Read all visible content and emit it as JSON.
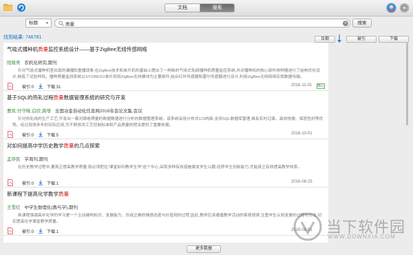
{
  "tabs": [
    {
      "label": "文档",
      "active": false
    },
    {
      "label": "搜索",
      "active": true
    }
  ],
  "search": {
    "field": "标题",
    "query": "质量",
    "button": "搜索"
  },
  "result_count": "找到结果: 746781",
  "sort": {
    "date": "日期",
    "cite": "被引",
    "download": "下载"
  },
  "results": [
    {
      "title_pre": "气吸式播种机",
      "title_hl": "质量",
      "title_post": "监控系统设计——基于ZigBee无线传感网络",
      "author": "阳陵秀",
      "source": "农机化研究,期刊",
      "abstract": "针对气吸式播种机室出现的漏播和重播现象,在ZigBee技术和单片机的基础上提出了一种新的气吸式免耕播种机质量监控系统,并对播种机的核心部件排种器进行了结构优化设计,制造了试验样机。播种质量监测系统以STC89C51单片机和ZigBee无线模块为主要部件,结合红外传感器和霍尔传感器进行设计,利用ZigBee无线网络实现数据传输。",
      "cite_label": "被引:0",
      "down_label": "下载:31",
      "date": "2016-11-01",
      "badge": "核心"
    },
    {
      "title_pre": "基于SQL的热轧过程",
      "title_hl": "质量",
      "title_post": "数据管理系统的研究与开发",
      "author": "曹凯;付守晓;白欣;龚增",
      "source": "全国冶金自动化信息网2016年会论文集,会议",
      "abstract": "针对热轧线的生产工艺,开发出一套对钢卷质量的数据数据进行分析的数据管理系统。该系统采用分布式C/S构架,支持SQL数据库管理,具有实时记录、高效快捷、保密性好等优势。经过现场多年的实际应用,为不断修改工艺控制标准和产品质量的把关提供了重要依据。",
      "cite_label": "被引:0",
      "down_label": "下载:5",
      "date": "2016-10-01",
      "badge": ""
    },
    {
      "title_pre": "对如何提高中学历史教学",
      "title_hl": "质量",
      "title_post": "的几点探索",
      "author": "孟存民",
      "source": "学周刊,期刊",
      "abstract": "在历史教学过程中,要真正提高教学质量,就必须把住\"课堂如何教学生学\"这个中心,采取多种有效措施激发学生兴趣,培养学生创新能力,才能真正有效提高教学效率。",
      "cite_label": "被引:0",
      "down_label": "下载:1",
      "date": "2016-08-25",
      "badge": ""
    },
    {
      "title_pre": "新课程下提高化学教学",
      "title_hl": "质量",
      "title_post": "",
      "author": "王雪红",
      "source": "中学生数理化(教与学),期刊",
      "abstract": "新课程强调高中化学的学习是一个主动建构知识、发展能力、形成正确的情感态度与价值观的过程,因此,教师应该遵循教学活动的客观规律,注重学生认知发展的过程与方法,切实提高化学课堂教学质量。",
      "cite_label": "被引:0",
      "down_label": "下载:1",
      "date": "2016-08-01",
      "badge": ""
    }
  ],
  "more_button": "更多数据",
  "watermark": {
    "title": "当下软件园",
    "url": "WWW.DOWNXIA.COM"
  },
  "colors": {
    "accent_blue": "#1b6fc5",
    "highlight_red": "#d01010",
    "author_green": "#3c8d3c"
  }
}
